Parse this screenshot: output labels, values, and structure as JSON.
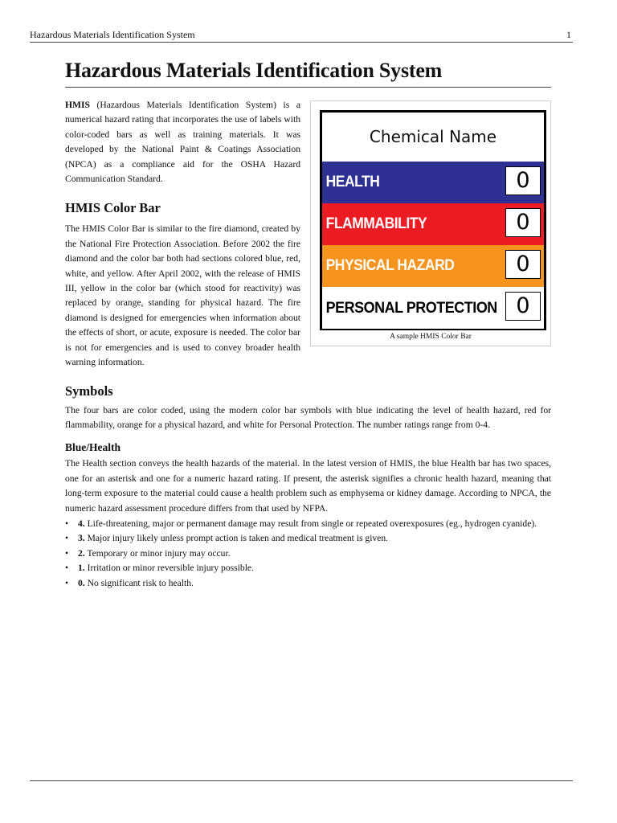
{
  "running_header": {
    "title": "Hazardous Materials Identification System",
    "page_number": "1"
  },
  "page_title": "Hazardous Materials Identification System",
  "intro": {
    "bold_term": "HMIS",
    "text": " (Hazardous Materials Identification System) is a numerical hazard rating that incorporates the use of labels with color-coded bars as well as training materials. It was developed by the National Paint & Coatings Association (NPCA) as a compliance aid for the OSHA Hazard Communication Standard."
  },
  "figure": {
    "chemical_name": "Chemical Name",
    "bars": [
      {
        "label": "HEALTH",
        "rating": "0",
        "color": "#2e3192"
      },
      {
        "label": "FLAMMABILITY",
        "rating": "0",
        "color": "#ed1c24"
      },
      {
        "label": "PHYSICAL HAZARD",
        "rating": "0",
        "color": "#f7941d"
      },
      {
        "label": "PERSONAL PROTECTION",
        "rating": "0",
        "color": "#ffffff"
      }
    ],
    "caption": "A sample HMIS Color Bar"
  },
  "sections": {
    "color_bar": {
      "heading": "HMIS Color Bar",
      "text": "The HMIS Color Bar is similar to the fire diamond, created by the National Fire Protection Association. Before 2002 the fire diamond and the color bar both had sections colored blue, red, white, and yellow. After April 2002, with the release of HMIS III, yellow in the color bar (which stood for reactivity) was replaced by orange, standing for physical hazard. The fire diamond is designed for emergencies when information about the effects of short, or acute, exposure is needed. The color bar is not for emergencies and is used to convey broader health warning information."
    },
    "symbols": {
      "heading": "Symbols",
      "text": "The four bars are color coded, using the modern color bar symbols with blue indicating the level of health hazard, red for flammability, orange for a physical hazard, and white for Personal Protection. The number ratings range from 0-4."
    },
    "blue_health": {
      "heading": "Blue/Health",
      "text": "The Health section conveys the health hazards of the material. In the latest version of HMIS, the blue Health bar has two spaces, one for an asterisk and one for a numeric hazard rating. If present, the asterisk signifies a chronic health hazard, meaning that long-term exposure to the material could cause a health problem such as emphysema or kidney damage. According to NPCA, the numeric hazard assessment procedure differs from that used by NFPA.",
      "levels": [
        {
          "number": "4.",
          "text": " Life-threatening, major or permanent damage may result from single or repeated overexposures (eg., hydrogen cyanide)."
        },
        {
          "number": "3.",
          "text": " Major injury likely unless prompt action is taken and medical treatment is given."
        },
        {
          "number": "2.",
          "text": " Temporary or minor injury may occur."
        },
        {
          "number": "1.",
          "text": " Irritation or minor reversible injury possible."
        },
        {
          "number": "0.",
          "text": " No significant risk to health."
        }
      ]
    }
  }
}
